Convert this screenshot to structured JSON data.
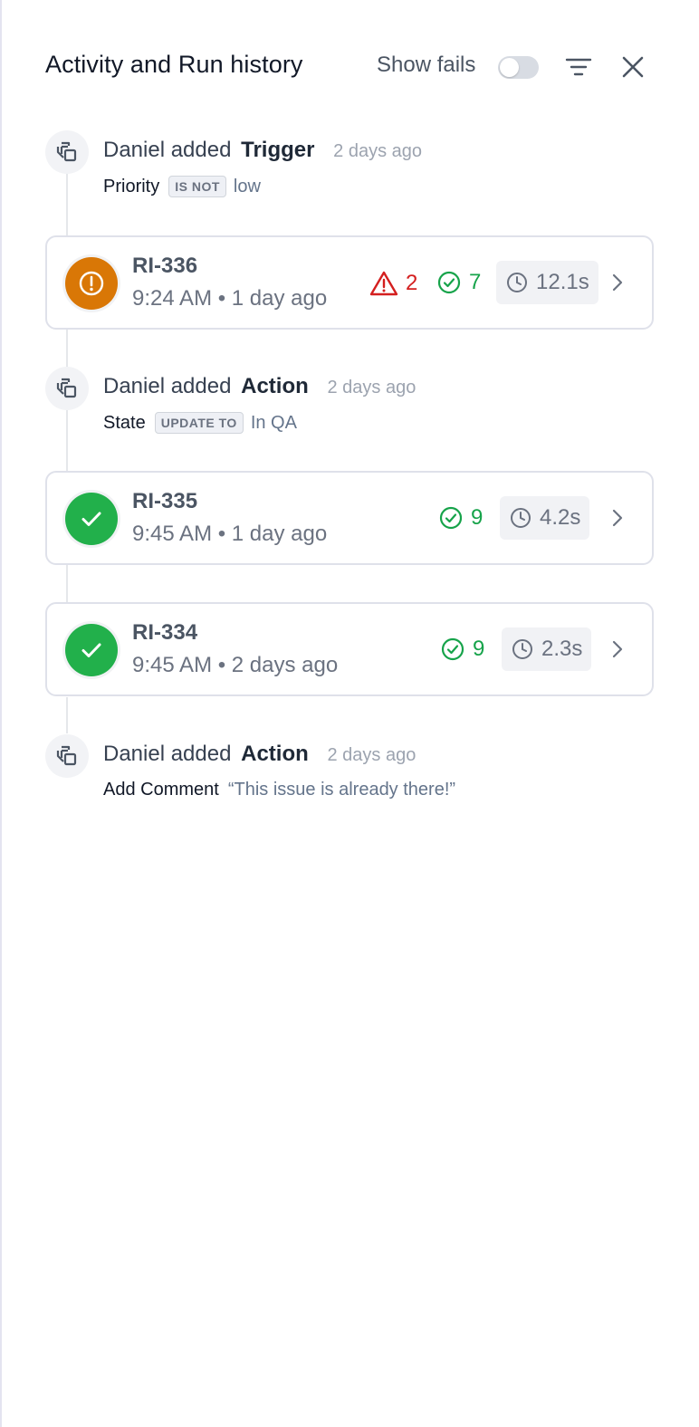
{
  "header": {
    "title": "Activity and Run history",
    "show_fails_label": "Show fails",
    "show_fails_enabled": false
  },
  "activities": [
    {
      "actor": "Daniel added",
      "object": "Trigger",
      "time_ago": "2 days ago",
      "field": "Priority",
      "operator": "IS NOT",
      "value": "low"
    },
    {
      "actor": "Daniel added",
      "object": "Action",
      "time_ago": "2 days ago",
      "field": "State",
      "operator": "UPDATE TO",
      "value": "In QA"
    },
    {
      "actor": "Daniel added",
      "object": "Action",
      "time_ago": "2 days ago",
      "field": "Add Comment",
      "quote": "“This issue is already there!”"
    }
  ],
  "runs": [
    {
      "id": "RI-336",
      "time": "9:24 AM • 1 day ago",
      "status": "warning",
      "errors": "2",
      "passed": "7",
      "duration": "12.1s"
    },
    {
      "id": "RI-335",
      "time": "9:45 AM • 1 day ago",
      "status": "success",
      "passed": "9",
      "duration": "4.2s"
    },
    {
      "id": "RI-334",
      "time": "9:45 AM • 2 days ago",
      "status": "success",
      "passed": "9",
      "duration": "2.3s"
    }
  ],
  "icons": {
    "activity": "stacked-squares-icon",
    "warning_status": "exclamation-circle-icon",
    "success_status": "check-icon",
    "errors": "warning-triangle-icon",
    "passed": "check-circle-icon",
    "duration": "clock-icon",
    "open": "chevron-right-icon",
    "filter": "filter-icon",
    "close": "close-icon"
  },
  "colors": {
    "warning": "#d97706",
    "success": "#22b04b",
    "error_text": "#d41f1f",
    "pass_text": "#16a34a"
  }
}
